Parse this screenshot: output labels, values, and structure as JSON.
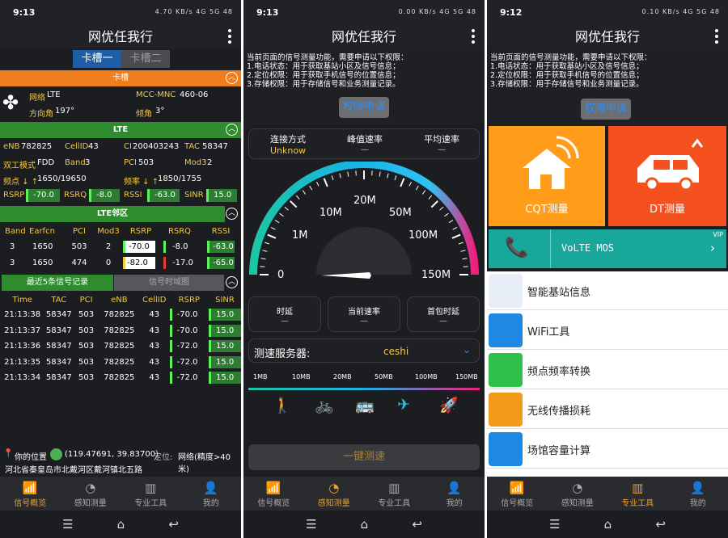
{
  "status": [
    {
      "time": "9:13",
      "right": "4.70 KB/s  4G 5G  48"
    },
    {
      "time": "9:13",
      "right": "0.00 KB/s  4G 5G  48"
    },
    {
      "time": "9:12",
      "right": "0.10 KB/s  4G 5G  48"
    }
  ],
  "app_title": "网优任我行",
  "nav": [
    {
      "label": "信号概览"
    },
    {
      "label": "感知测量"
    },
    {
      "label": "专业工具"
    },
    {
      "label": "我的"
    }
  ],
  "s1": {
    "slot_tabs": [
      "卡槽一",
      "卡槽二"
    ],
    "card_header": "卡槽",
    "network": {
      "k1": "网络",
      "v1": "LTE",
      "k2": "MCC-MNC",
      "v2": "460-06",
      "k3": "方向角",
      "v3": "197°",
      "k4": "倾角",
      "v4": "3°"
    },
    "lte_header": "LTE",
    "lte": {
      "enb_k": "eNB",
      "enb": "782825",
      "cellid_k": "CellID",
      "cellid": "43",
      "ci_k": "CI",
      "ci": "200403243",
      "tac_k": "TAC",
      "tac": "58347",
      "duplex_k": "双工模式",
      "duplex": "FDD",
      "band_k": "Band",
      "band": "3",
      "pci_k": "PCI",
      "pci": "503",
      "mod3_k": "Mod3",
      "mod3": "2",
      "freq_k": "频点 ↓ ↑",
      "freq": "1650/19650",
      "rate_k": "频率 ↓ ↑",
      "rate": "1850/1755",
      "rsrp_k": "RSRP",
      "rsrp": "-70.0",
      "rsrq_k": "RSRQ",
      "rsrq": "-8.0",
      "rssi_k": "RSSI",
      "rssi": "-63.0",
      "sinr_k": "SINR",
      "sinr": "15.0"
    },
    "neighbor_header": "LTE邻区",
    "neighbor_cols": [
      "Band",
      "Earfcn",
      "PCI",
      "Mod3",
      "RSRP",
      "RSRQ",
      "RSSI"
    ],
    "neighbor_rows": [
      [
        "3",
        "1650",
        "503",
        "2",
        "-70.0",
        "-8.0",
        "-63.0"
      ],
      [
        "3",
        "1650",
        "474",
        "0",
        "-82.0",
        "-17.0",
        "-65.0"
      ]
    ],
    "hist_tabs": [
      "最近5条信号记录",
      "信号时域图"
    ],
    "hist_cols": [
      "Time",
      "TAC",
      "PCI",
      "eNB",
      "CellID",
      "RSRP",
      "SINR"
    ],
    "hist_rows": [
      [
        "21:13:38",
        "58347",
        "503",
        "782825",
        "43",
        "-70.0",
        "15.0"
      ],
      [
        "21:13:37",
        "58347",
        "503",
        "782825",
        "43",
        "-70.0",
        "15.0"
      ],
      [
        "21:13:36",
        "58347",
        "503",
        "782825",
        "43",
        "-72.0",
        "15.0"
      ],
      [
        "21:13:35",
        "58347",
        "503",
        "782825",
        "43",
        "-72.0",
        "15.0"
      ],
      [
        "21:13:34",
        "58347",
        "503",
        "782825",
        "43",
        "-72.0",
        "15.0"
      ]
    ],
    "location": {
      "label": "你的位置",
      "coords": "(119.47691, 39.83700)",
      "mode_k": "定位:",
      "mode": "网络(精度>40米)",
      "addr": "河北省秦皇岛市北戴河区戴河镇北五路"
    }
  },
  "perm_text": [
    "当前页面的信号测量功能，需要申请以下权限：",
    "1.电话状态：用于获取基站小区及信号信息；",
    "2.定位权限：用于获取手机信号的位置信息；",
    "3.存储权限：用于存储信号和业务测量记录。"
  ],
  "perm_button": "权限申请",
  "s2": {
    "stats": [
      {
        "label": "连接方式",
        "value": "Unknow"
      },
      {
        "label": "峰值速率",
        "value": "—"
      },
      {
        "label": "平均速率",
        "value": "—"
      }
    ],
    "gauge_labels": [
      "0",
      "1M",
      "10M",
      "20M",
      "50M",
      "100M",
      "150M"
    ],
    "stats2": [
      {
        "label": "时延",
        "value": "—"
      },
      {
        "label": "当前速率",
        "value": "—"
      },
      {
        "label": "首包时延",
        "value": "—"
      }
    ],
    "server_label": "测速服务器:",
    "server_value": "ceshi",
    "scale": [
      "1MB",
      "10MB",
      "20MB",
      "50MB",
      "100MB",
      "150MB"
    ],
    "start_button": "一键测速"
  },
  "s3": {
    "cqt": "CQT测量",
    "dt": "DT测量",
    "volte": "VoLTE MOS",
    "vip": "VIP",
    "tools": [
      "智能基站信息",
      "WiFi工具",
      "频点频率转换",
      "无线传播损耗",
      "场馆容量计算"
    ],
    "colors": {
      "orange": "#ff9c19",
      "red": "#f5511e",
      "teal": "#17a79b"
    }
  }
}
